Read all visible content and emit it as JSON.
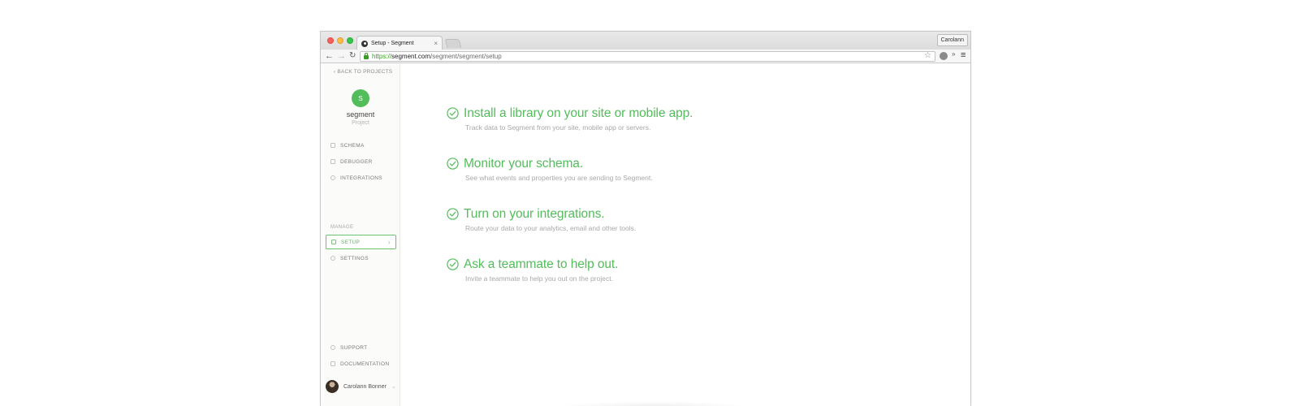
{
  "browser": {
    "tab_title": "Setup - Segment",
    "tab_close": "×",
    "profile_name": "Carolann",
    "url_scheme": "https://",
    "url_domain": "segment.com",
    "url_path": "/segment/segment/setup",
    "star_icon": "☆",
    "back_icon": "←",
    "forward_icon": "→",
    "reload_icon": "↻",
    "more_icon": "»",
    "menu_icon": "≡"
  },
  "sidebar": {
    "back_link": "‹  BACK TO PROJECTS",
    "avatar_letter": "S",
    "project_name": "segment",
    "project_type": "Project",
    "nav_items": [
      {
        "label": "SCHEMA",
        "icon": "schema-icon"
      },
      {
        "label": "DEBUGGER",
        "icon": "debugger-icon"
      },
      {
        "label": "INTEGRATIONS",
        "icon": "integrations-icon"
      }
    ],
    "manage_label": "MANAGE",
    "manage_items": [
      {
        "label": "SETUP",
        "icon": "setup-icon",
        "active": true
      },
      {
        "label": "SETTINGS",
        "icon": "settings-icon"
      }
    ],
    "footer_items": [
      {
        "label": "SUPPORT",
        "icon": "support-icon"
      },
      {
        "label": "DOCUMENTATION",
        "icon": "documentation-icon"
      }
    ],
    "user_name": "Carolann Bonner",
    "chevron": "›"
  },
  "main": {
    "steps": [
      {
        "title": "Install a library on your site or mobile app.",
        "description": "Track data to Segment from your site, mobile app or servers."
      },
      {
        "title": "Monitor your schema.",
        "description": "See what events and properties you are sending to Segment."
      },
      {
        "title": "Turn on your integrations.",
        "description": "Route your data to your analytics, email and other tools."
      },
      {
        "title": "Ask a teammate to help out.",
        "description": "Invite a teammate to help you out on the project."
      }
    ]
  },
  "colors": {
    "accent": "#52bd5a",
    "muted_text": "#a8a8a8",
    "sidebar_bg": "#fbfbf9"
  }
}
